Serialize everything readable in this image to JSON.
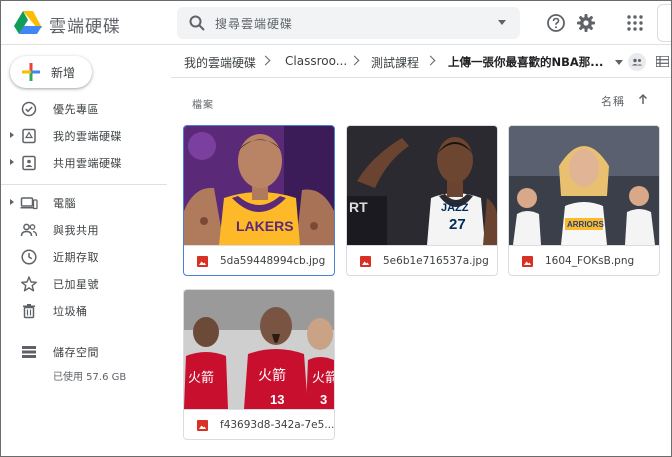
{
  "header": {
    "app_title": "雲端硬碟",
    "search_placeholder": "搜尋雲端硬碟"
  },
  "sidebar": {
    "new_label": "新增",
    "items": [
      {
        "label": "優先專區"
      },
      {
        "label": "我的雲端硬碟"
      },
      {
        "label": "共用雲端硬碟"
      },
      {
        "label": "電腦"
      },
      {
        "label": "與我共用"
      },
      {
        "label": "近期存取"
      },
      {
        "label": "已加星號"
      },
      {
        "label": "垃圾桶"
      },
      {
        "label": "儲存空間"
      }
    ],
    "storage_used": "已使用 57.6 GB"
  },
  "breadcrumb": {
    "items": [
      "我的雲端硬碟",
      "Classroo...",
      "測試課程",
      "上傳一張你最喜歡的NBA那..."
    ]
  },
  "main": {
    "section_label": "檔案",
    "sort_label": "名稱"
  },
  "files": [
    {
      "name": "5da59448994cb.jpg"
    },
    {
      "name": "5e6b1e716537a.jpg"
    },
    {
      "name": "1604_FOKsB.png"
    },
    {
      "name": "f43693d8-342a-7e5..."
    }
  ],
  "colors": {
    "accent_blue": "#4a7fd6",
    "file_red": "#d93025",
    "lakers_gold": "#fdb927",
    "rockets_red": "#c8102e"
  }
}
